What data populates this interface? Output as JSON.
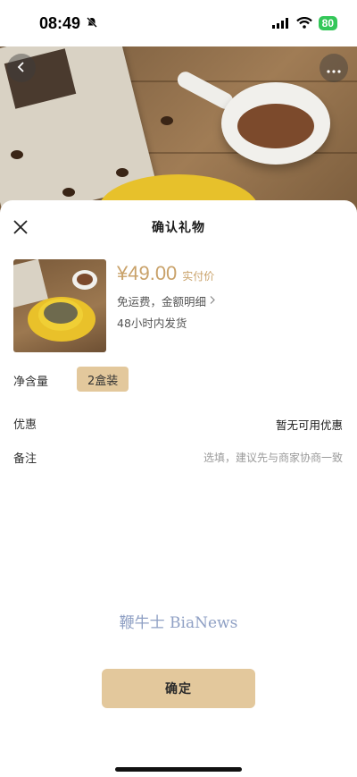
{
  "status_bar": {
    "time": "08:49",
    "battery": "80"
  },
  "sheet": {
    "title": "确认礼物"
  },
  "product": {
    "price": "¥49.00",
    "price_tag": "实付价",
    "shipping": "免运费，金额明细",
    "delivery": "48小时内发货"
  },
  "spec": {
    "label": "净含量",
    "selected": "2盒装"
  },
  "discount": {
    "label": "优惠",
    "value": "暂无可用优惠"
  },
  "remark": {
    "label": "备注",
    "placeholder": "选填，建议先与商家协商一致"
  },
  "watermark": "鞭牛士 BiaNews",
  "confirm_label": "确定",
  "colors": {
    "accent": "#e3c89c",
    "price": "#c9a26a"
  }
}
